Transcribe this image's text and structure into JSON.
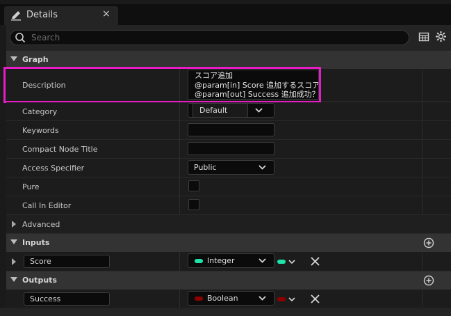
{
  "tab": {
    "title": "Details",
    "close": "×",
    "icon": "pencil-icon"
  },
  "search": {
    "placeholder": "Search"
  },
  "sections": {
    "graph": "Graph",
    "inputs": "Inputs",
    "outputs": "Outputs"
  },
  "graph": {
    "description_label": "Description",
    "description_lines": [
      "スコア追加",
      "@param[in] Score 追加するスコア",
      "@param[out] Success 追加成功？"
    ],
    "category_label": "Category",
    "category_value": "Default",
    "keywords_label": "Keywords",
    "keywords_value": "",
    "compact_title_label": "Compact Node Title",
    "compact_title_value": "",
    "access_label": "Access Specifier",
    "access_value": "Public",
    "pure_label": "Pure",
    "pure_checked": false,
    "call_in_editor_label": "Call In Editor",
    "call_in_editor_checked": false,
    "advanced_label": "Advanced"
  },
  "inputs": [
    {
      "name": "Score",
      "type": "Integer",
      "color": "#1fe3a8"
    }
  ],
  "outputs": [
    {
      "name": "Success",
      "type": "Boolean",
      "color": "#8e0000"
    }
  ],
  "colors": {
    "highlight": "#e81cc6"
  }
}
